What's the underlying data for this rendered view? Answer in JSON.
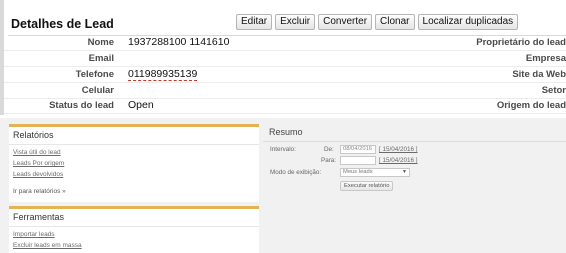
{
  "detail": {
    "title": "Detalhes de Lead",
    "buttons": [
      "Editar",
      "Excluir",
      "Converter",
      "Clonar",
      "Localizar duplicadas"
    ],
    "fields_left": [
      {
        "label": "Nome",
        "value": "1937288100 1141610"
      },
      {
        "label": "Email",
        "value": ""
      },
      {
        "label": "Telefone",
        "value": "011989935139"
      },
      {
        "label": "Celular",
        "value": ""
      },
      {
        "label": "Status do lead",
        "value": "Open"
      }
    ],
    "fields_right": [
      "Proprietário do lead",
      "Empresa",
      "Site da Web",
      "Setor",
      "Origem do lead"
    ]
  },
  "reports": {
    "title": "Relatórios",
    "links": [
      "Vista útil do lead",
      "Leads Por origem",
      "Leads devolvidos"
    ],
    "more": "Ir para relatórios »"
  },
  "tools": {
    "title": "Ferramentas",
    "links": [
      "Importar leads",
      "Excluir leads em massa"
    ]
  },
  "summary": {
    "title": "Resumo",
    "interval_label": "Intervalo:",
    "from_label": "De:",
    "from_value": "08/04/2016",
    "from_link": "[ 15/04/2016 ]",
    "to_label": "Para:",
    "to_value": "",
    "to_link": "[ 15/04/2016 ]",
    "view_label": "Modo de exibição:",
    "view_value": "Meus leads",
    "run_button": "Executar relatório"
  }
}
